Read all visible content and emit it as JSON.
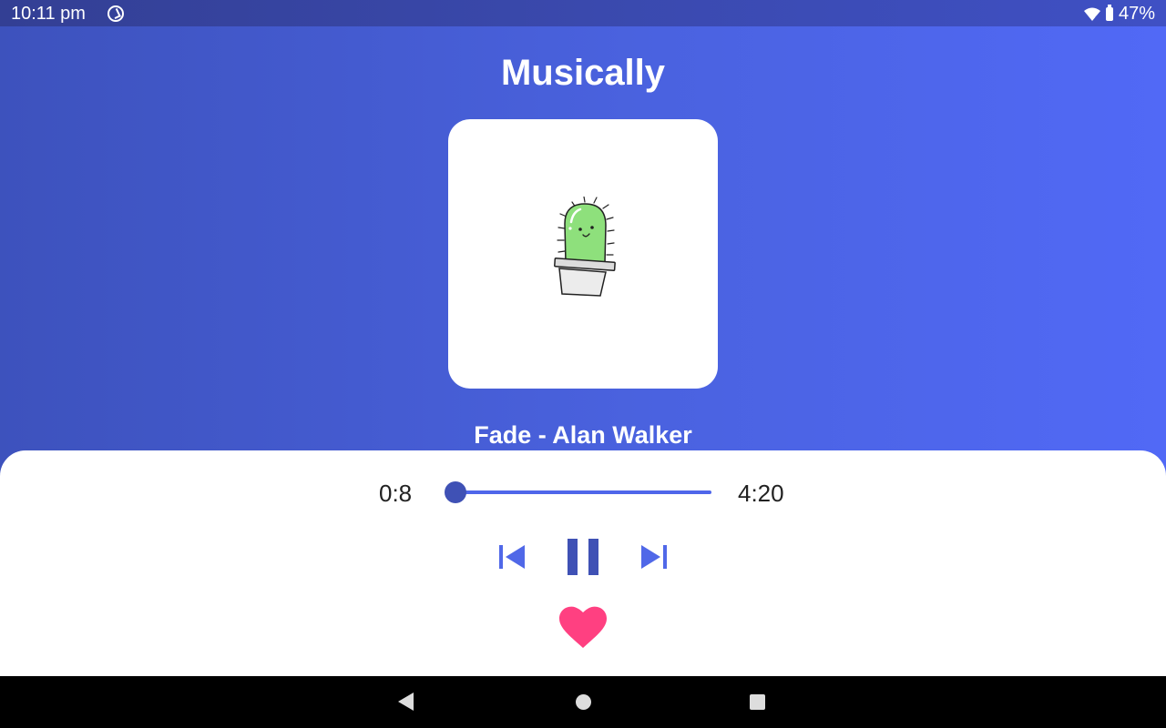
{
  "status_bar": {
    "time": "10:11 pm",
    "battery": "47%",
    "icons": [
      "sync-icon",
      "wifi-icon",
      "battery-icon"
    ]
  },
  "app": {
    "title": "Musically"
  },
  "album_art": {
    "icon": "cactus-illustration"
  },
  "track": {
    "title": "Fade - Alan Walker"
  },
  "player": {
    "current_time": "0:8",
    "total_time": "4:20",
    "progress": 0.03,
    "state": "playing",
    "controls": [
      "previous-icon",
      "pause-icon",
      "next-icon"
    ],
    "liked": true
  },
  "colors": {
    "accent": "#3f51b5",
    "seek_bar": "#4f66ea",
    "gradient_start": "#3d52bd",
    "gradient_end": "#5169f6",
    "like": "#ff4081"
  },
  "nav_bar": {
    "buttons": [
      "back-icon",
      "home-icon",
      "recents-icon"
    ]
  }
}
